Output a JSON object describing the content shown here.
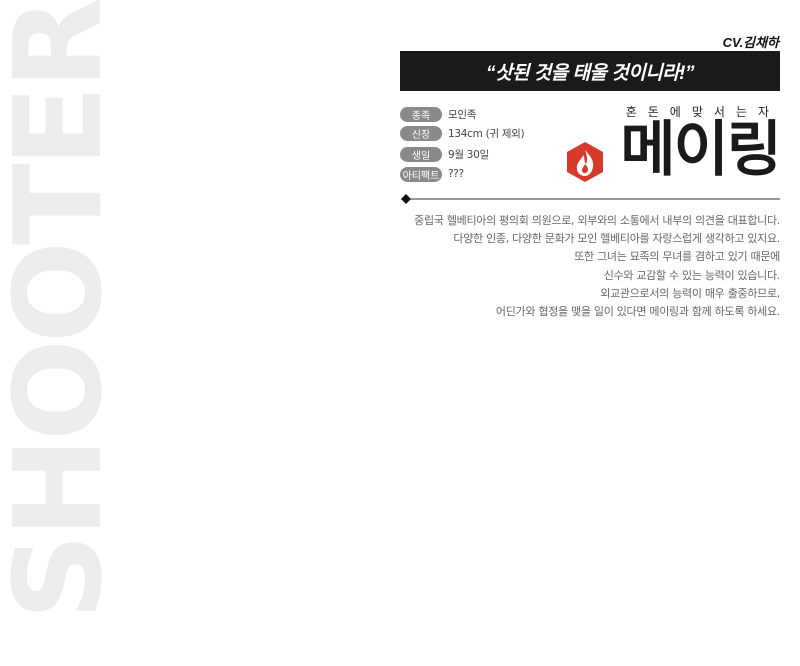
{
  "role_watermark": "SHOOTER",
  "voice_actor": "CV.김채하",
  "quote": "“삿된 것을 태울 것이니라!”",
  "hero": {
    "subtitle": "혼돈에맞서는자",
    "name": "메이링",
    "logo_icon": "flame-hexagon-icon"
  },
  "info": [
    {
      "label": "종족",
      "value": "모인족"
    },
    {
      "label": "신장",
      "value": "134cm (귀 제외)"
    },
    {
      "label": "생일",
      "value": "9월 30일"
    },
    {
      "label": "아티팩트",
      "value": "???"
    }
  ],
  "bio_lines": [
    "중립국 헬베티아의 평의회 의원으로, 외부와의 소통에서 내부의 의견을 대표합니다.",
    "다양한 인종, 다양한 문화가 모인 헬베티아를 자랑스럽게 생각하고 있지요.",
    "또한 그녀는 묘족의 무녀를 겸하고 있기 때문에",
    "신수와 교감할 수 있는 능력이 있습니다.",
    "외교관으로서의 능력이 매우 출중하므로,",
    "어딘가와 협정을 맺을 일이 있다면 메이링과 함께 하도록 하세요."
  ],
  "colors": {
    "quote_bg": "#1a1a1a",
    "pill_bg": "#8a8a8a",
    "logo_red": "#d63a2a",
    "watermark": "#ececec"
  }
}
